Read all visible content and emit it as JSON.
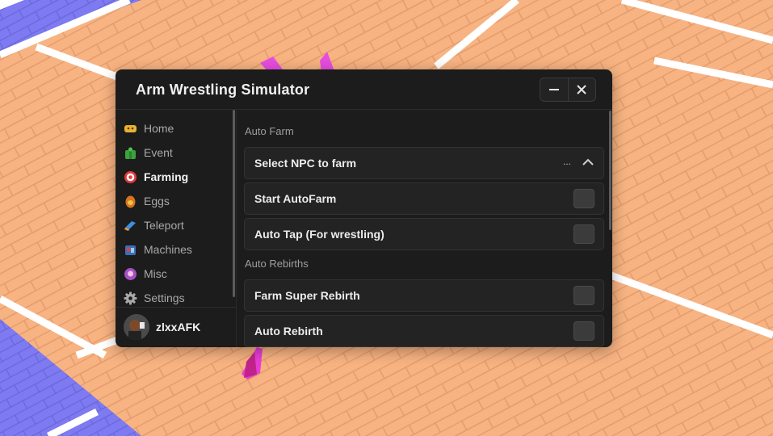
{
  "window": {
    "title": "Arm Wrestling Simulator",
    "minimize_icon": "minus-icon",
    "close_icon": "close-icon"
  },
  "sidebar": {
    "items": [
      {
        "label": "Home",
        "icon": "home-emoji-icon",
        "active": false
      },
      {
        "label": "Event",
        "icon": "gift-icon",
        "active": false
      },
      {
        "label": "Farming",
        "icon": "target-icon",
        "active": true
      },
      {
        "label": "Eggs",
        "icon": "egg-icon",
        "active": false
      },
      {
        "label": "Teleport",
        "icon": "teleport-icon",
        "active": false
      },
      {
        "label": "Machines",
        "icon": "machine-icon",
        "active": false
      },
      {
        "label": "Misc",
        "icon": "misc-icon",
        "active": false
      },
      {
        "label": "Settings",
        "icon": "gear-icon",
        "active": false
      }
    ]
  },
  "profile": {
    "username": "zlxxAFK"
  },
  "content": {
    "auto_farm": {
      "section_title": "Auto Farm",
      "dropdown": {
        "label": "Select NPC to farm",
        "value": "...",
        "icon": "chevron-up-icon"
      },
      "toggles": [
        {
          "label": "Start AutoFarm",
          "enabled": false
        },
        {
          "label": "Auto Tap (For wrestling)",
          "enabled": false
        }
      ]
    },
    "auto_rebirths": {
      "section_title": "Auto Rebirths",
      "toggles": [
        {
          "label": "Farm Super Rebirth",
          "enabled": false
        },
        {
          "label": "Auto Rebirth",
          "enabled": false
        }
      ]
    }
  },
  "colors": {
    "window_bg": "#1c1c1c",
    "row_bg": "#232323",
    "toggle_off": "#3b3b3b",
    "floor": "#f6b07e",
    "floor_blue": "#7b78f0"
  }
}
